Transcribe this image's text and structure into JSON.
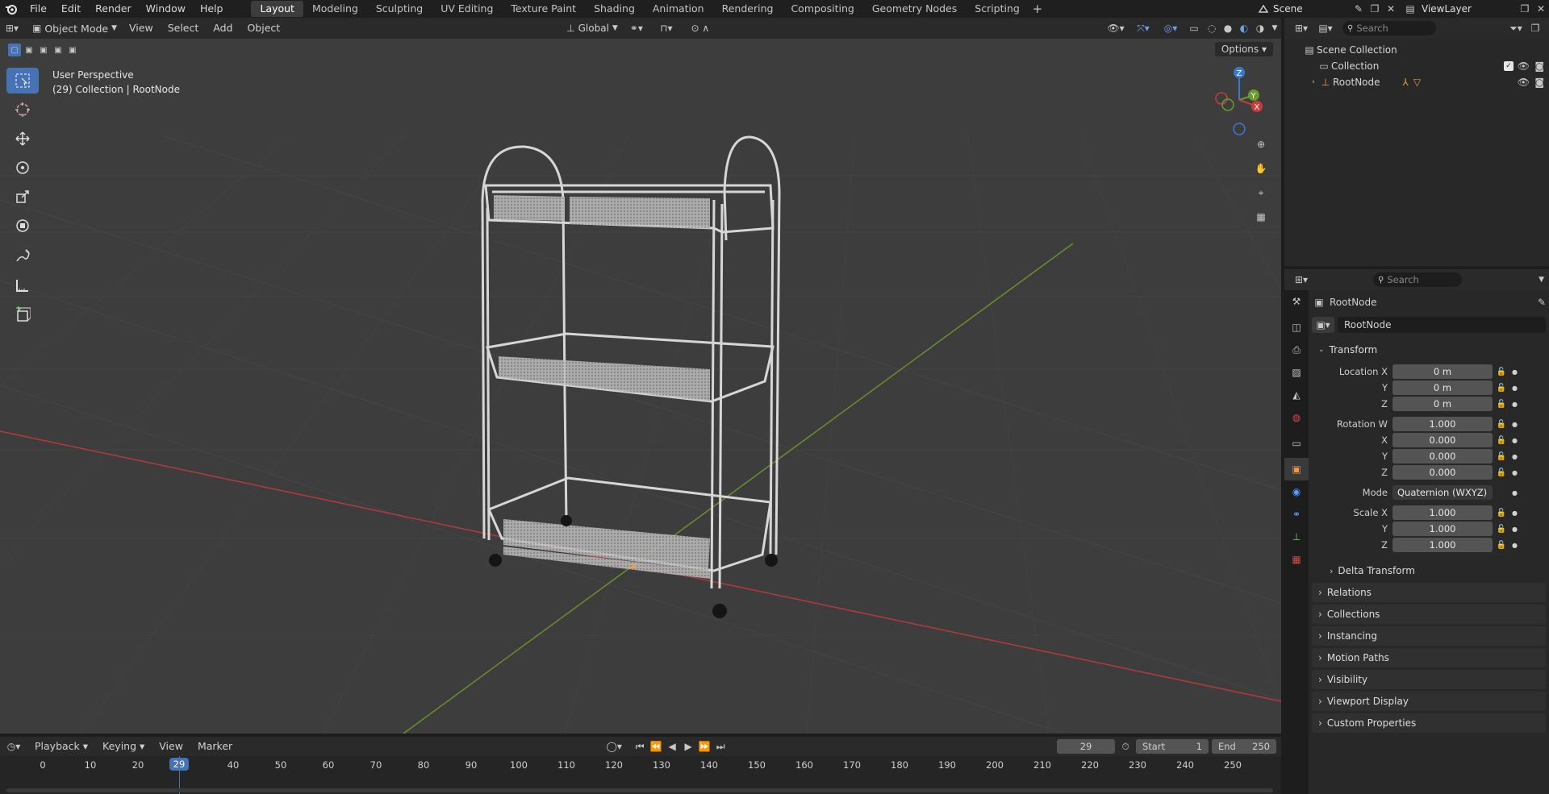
{
  "menu": [
    "File",
    "Edit",
    "Render",
    "Window",
    "Help"
  ],
  "workspaces": [
    "Layout",
    "Modeling",
    "Sculpting",
    "UV Editing",
    "Texture Paint",
    "Shading",
    "Animation",
    "Rendering",
    "Compositing",
    "Geometry Nodes",
    "Scripting"
  ],
  "active_workspace": "Layout",
  "scene": "Scene",
  "view_layer": "ViewLayer",
  "viewport_header": {
    "mode": "Object Mode",
    "menus": [
      "View",
      "Select",
      "Add",
      "Object"
    ],
    "orientation": "Global"
  },
  "overlay": {
    "line1": "User Perspective",
    "line2": "(29) Collection | RootNode"
  },
  "options_label": "Options",
  "gizmo": {
    "z": "Z",
    "y": "Y",
    "x": "X"
  },
  "outliner": {
    "search_placeholder": "Search",
    "items": [
      {
        "label": "Scene Collection"
      },
      {
        "label": "Collection"
      },
      {
        "label": "RootNode"
      }
    ]
  },
  "properties": {
    "search_placeholder": "Search",
    "object_name": "RootNode",
    "data_name": "RootNode",
    "transform_title": "Transform",
    "location": {
      "label_x": "Location X",
      "label_y": "Y",
      "label_z": "Z",
      "x": "0 m",
      "y": "0 m",
      "z": "0 m"
    },
    "rotation": {
      "label_w": "Rotation W",
      "label_x": "X",
      "label_y": "Y",
      "label_z": "Z",
      "w": "1.000",
      "x": "0.000",
      "y": "0.000",
      "z": "0.000"
    },
    "mode_label": "Mode",
    "mode_value": "Quaternion (WXYZ)",
    "scale": {
      "label_x": "Scale X",
      "label_y": "Y",
      "label_z": "Z",
      "x": "1.000",
      "y": "1.000",
      "z": "1.000"
    },
    "delta_transform": "Delta Transform",
    "panels": [
      "Relations",
      "Collections",
      "Instancing",
      "Motion Paths",
      "Visibility",
      "Viewport Display",
      "Custom Properties"
    ]
  },
  "timeline": {
    "menus": [
      "Playback",
      "Keying",
      "View",
      "Marker"
    ],
    "current_frame": "29",
    "start_label": "Start",
    "start": "1",
    "end_label": "End",
    "end": "250",
    "ticks": [
      "0",
      "10",
      "20",
      "29",
      "40",
      "50",
      "60",
      "70",
      "80",
      "90",
      "100",
      "110",
      "120",
      "130",
      "140",
      "150",
      "160",
      "170",
      "180",
      "190",
      "200",
      "210",
      "220",
      "230",
      "240",
      "250"
    ]
  },
  "colors": {
    "accent": "#4772b3",
    "x_axis": "#c83c3c",
    "y_axis": "#6b9b2e",
    "z_axis": "#3a78c9"
  }
}
